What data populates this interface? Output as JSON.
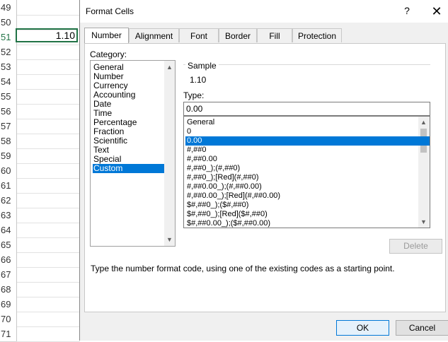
{
  "sheet": {
    "rows": [
      "49",
      "50",
      "51",
      "52",
      "53",
      "54",
      "55",
      "56",
      "57",
      "58",
      "59",
      "60",
      "61",
      "62",
      "63",
      "64",
      "65",
      "66",
      "67",
      "68",
      "69",
      "70",
      "71"
    ],
    "active_cell_value": "1.10"
  },
  "dialog": {
    "title": "Format Cells",
    "help": "?",
    "close": "✕",
    "tabs": [
      "Number",
      "Alignment",
      "Font",
      "Border",
      "Fill",
      "Protection"
    ],
    "category_label": "Category:",
    "categories": [
      "General",
      "Number",
      "Currency",
      "Accounting",
      "Date",
      "Time",
      "Percentage",
      "Fraction",
      "Scientific",
      "Text",
      "Special",
      "Custom"
    ],
    "selected_category": "Custom",
    "sample_label": "Sample",
    "sample_value": "1.10",
    "type_label": "Type:",
    "type_value": "0.00",
    "formats": [
      "General",
      "0",
      "0.00",
      "#,##0",
      "#,##0.00",
      "#,##0_);(#,##0)",
      "#,##0_);[Red](#,##0)",
      "#,##0.00_);(#,##0.00)",
      "#,##0.00_);[Red](#,##0.00)",
      "$#,##0_);($#,##0)",
      "$#,##0_);[Red]($#,##0)",
      "$#,##0.00_);($#,##0.00)"
    ],
    "selected_format": "0.00",
    "delete_label": "Delete",
    "hint": "Type the number format code, using one of the existing codes as a starting point.",
    "ok_label": "OK",
    "cancel_label": "Cancel",
    "accent_color": "#0078d7",
    "selection_color": "#217346"
  }
}
